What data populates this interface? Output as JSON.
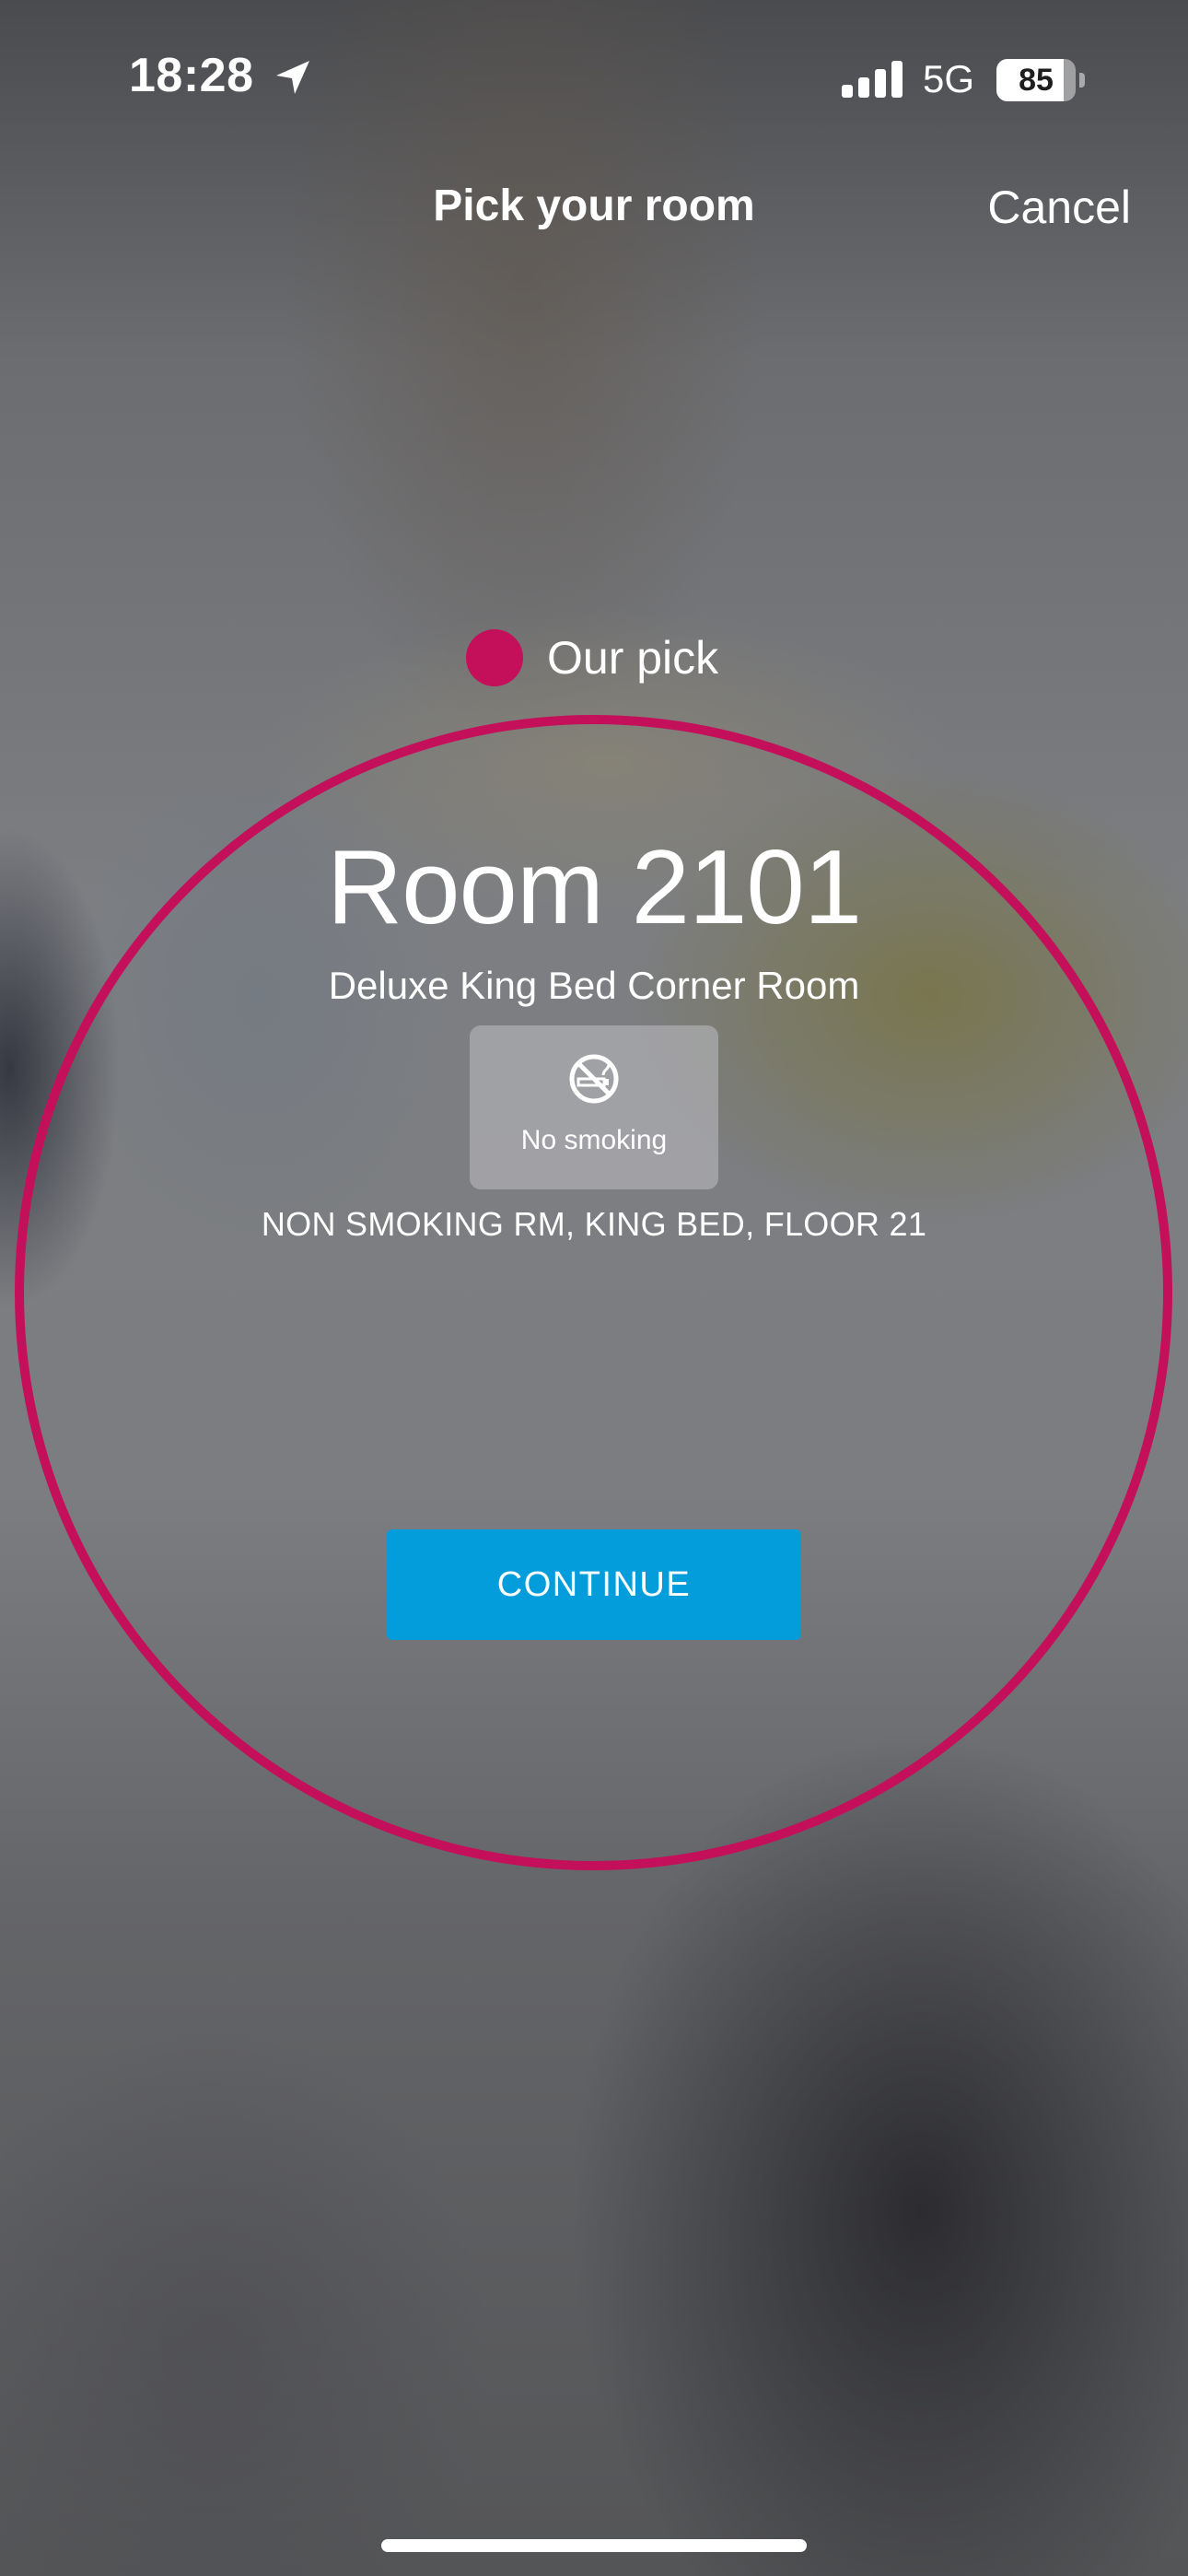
{
  "status_bar": {
    "time": "18:28",
    "network": "5G",
    "battery_level": "85",
    "battery_percent": 85
  },
  "header": {
    "title": "Pick your room",
    "cancel_label": "Cancel"
  },
  "pick": {
    "label": "Our pick",
    "color": "#c4105a"
  },
  "room": {
    "title": "Room 2101",
    "type": "Deluxe King Bed Corner Room",
    "amenity": {
      "icon": "no-smoking-icon",
      "label": "No smoking"
    },
    "details": "NON SMOKING RM, KING BED, FLOOR 21"
  },
  "continue_label": "CONTINUE",
  "colors": {
    "accent": "#c4105a",
    "button": "#039ddc"
  }
}
